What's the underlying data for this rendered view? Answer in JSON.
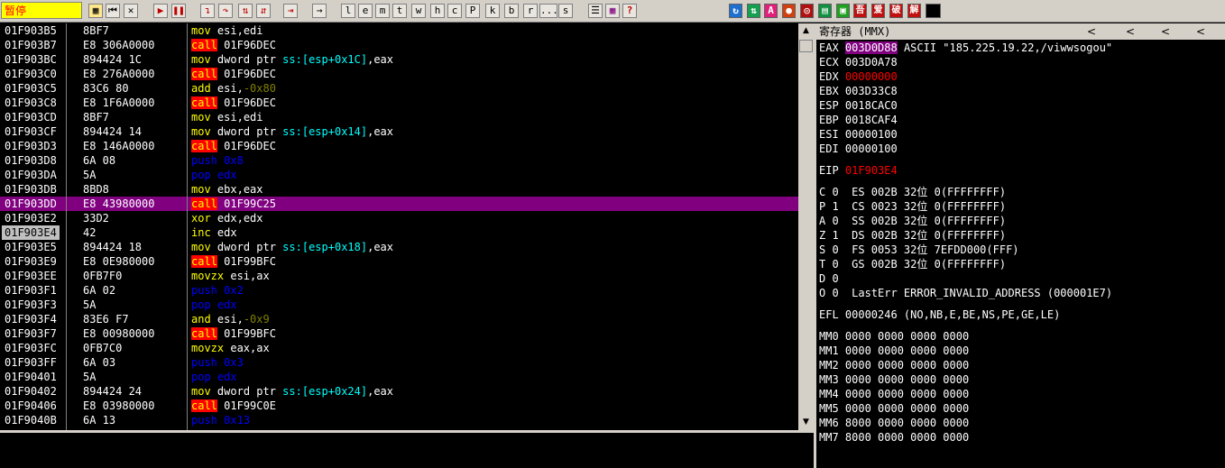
{
  "toolbar": {
    "status": "暂停",
    "buttons": [
      "l",
      "e",
      "m",
      "t",
      "w",
      "h",
      "c",
      "P",
      "k",
      "b",
      "r",
      "...",
      "s"
    ],
    "right_icons": [
      "A",
      "吾",
      "爱",
      "破",
      "解"
    ]
  },
  "disasm": [
    {
      "addr": "01F903B5",
      "hex": "8BF7",
      "mn": "mov",
      "ops": [
        [
          "w",
          "esi,edi"
        ]
      ]
    },
    {
      "addr": "01F903B7",
      "hex": "E8 306A0000",
      "mn": "call",
      "ops": [
        [
          "w",
          "01F96DEC"
        ]
      ]
    },
    {
      "addr": "01F903BC",
      "hex": "894424 1C",
      "mn": "mov",
      "ops": [
        [
          "w",
          "dword ptr "
        ],
        [
          "c",
          "ss:[esp+0x1C]"
        ],
        [
          "w",
          ",eax"
        ]
      ]
    },
    {
      "addr": "01F903C0",
      "hex": "E8 276A0000",
      "mn": "call",
      "ops": [
        [
          "w",
          "01F96DEC"
        ]
      ]
    },
    {
      "addr": "01F903C5",
      "hex": "83C6 80",
      "mn": "add",
      "ops": [
        [
          "w",
          "esi,"
        ],
        [
          "g",
          "-0x80"
        ]
      ]
    },
    {
      "addr": "01F903C8",
      "hex": "E8 1F6A0000",
      "mn": "call",
      "ops": [
        [
          "w",
          "01F96DEC"
        ]
      ]
    },
    {
      "addr": "01F903CD",
      "hex": "8BF7",
      "mn": "mov",
      "ops": [
        [
          "w",
          "esi,edi"
        ]
      ]
    },
    {
      "addr": "01F903CF",
      "hex": "894424 14",
      "mn": "mov",
      "ops": [
        [
          "w",
          "dword ptr "
        ],
        [
          "c",
          "ss:[esp+0x14]"
        ],
        [
          "w",
          ",eax"
        ]
      ]
    },
    {
      "addr": "01F903D3",
      "hex": "E8 146A0000",
      "mn": "call",
      "ops": [
        [
          "w",
          "01F96DEC"
        ]
      ]
    },
    {
      "addr": "01F903D8",
      "hex": "6A 08",
      "mn": "push",
      "ops": [
        [
          "g",
          "0x8"
        ]
      ]
    },
    {
      "addr": "01F903DA",
      "hex": "5A",
      "mn": "pop",
      "ops": [
        [
          "n",
          "edx"
        ]
      ]
    },
    {
      "addr": "01F903DB",
      "hex": "8BD8",
      "mn": "mov",
      "ops": [
        [
          "w",
          "ebx,eax"
        ]
      ]
    },
    {
      "addr": "01F903DD",
      "hex": "E8 43980000",
      "mn": "call",
      "ops": [
        [
          "w",
          "01F99C25"
        ]
      ],
      "sel": true
    },
    {
      "addr": "01F903E2",
      "hex": "33D2",
      "mn": "xor",
      "ops": [
        [
          "w",
          "edx,edx"
        ]
      ]
    },
    {
      "addr": "01F903E4",
      "hex": "42",
      "mn": "inc",
      "ops": [
        [
          "w",
          "edx"
        ]
      ],
      "eip": true
    },
    {
      "addr": "01F903E5",
      "hex": "894424 18",
      "mn": "mov",
      "ops": [
        [
          "w",
          "dword ptr "
        ],
        [
          "c",
          "ss:[esp+0x18]"
        ],
        [
          "w",
          ",eax"
        ]
      ]
    },
    {
      "addr": "01F903E9",
      "hex": "E8 0E980000",
      "mn": "call",
      "ops": [
        [
          "w",
          "01F99BFC"
        ]
      ]
    },
    {
      "addr": "01F903EE",
      "hex": "0FB7F0",
      "mn": "movzx",
      "ops": [
        [
          "w",
          "esi,ax"
        ]
      ]
    },
    {
      "addr": "01F903F1",
      "hex": "6A 02",
      "mn": "push",
      "ops": [
        [
          "g",
          "0x2"
        ]
      ]
    },
    {
      "addr": "01F903F3",
      "hex": "5A",
      "mn": "pop",
      "ops": [
        [
          "n",
          "edx"
        ]
      ]
    },
    {
      "addr": "01F903F4",
      "hex": "83E6 F7",
      "mn": "and",
      "ops": [
        [
          "w",
          "esi,"
        ],
        [
          "g",
          "-0x9"
        ]
      ]
    },
    {
      "addr": "01F903F7",
      "hex": "E8 00980000",
      "mn": "call",
      "ops": [
        [
          "w",
          "01F99BFC"
        ]
      ]
    },
    {
      "addr": "01F903FC",
      "hex": "0FB7C0",
      "mn": "movzx",
      "ops": [
        [
          "w",
          "eax,ax"
        ]
      ]
    },
    {
      "addr": "01F903FF",
      "hex": "6A 03",
      "mn": "push",
      "ops": [
        [
          "g",
          "0x3"
        ]
      ]
    },
    {
      "addr": "01F90401",
      "hex": "5A",
      "mn": "pop",
      "ops": [
        [
          "n",
          "edx"
        ]
      ]
    },
    {
      "addr": "01F90402",
      "hex": "894424 24",
      "mn": "mov",
      "ops": [
        [
          "w",
          "dword ptr "
        ],
        [
          "c",
          "ss:[esp+0x24]"
        ],
        [
          "w",
          ",eax"
        ]
      ]
    },
    {
      "addr": "01F90406",
      "hex": "E8 03980000",
      "mn": "call",
      "ops": [
        [
          "w",
          "01F99C0E"
        ]
      ]
    },
    {
      "addr": "01F9040B",
      "hex": "6A 13",
      "mn": "push",
      "ops": [
        [
          "g",
          "0x13"
        ]
      ]
    }
  ],
  "registers": {
    "title": "寄存器 (MMX)",
    "nav": [
      "<",
      "<",
      "<",
      "<",
      "<"
    ],
    "gp": [
      {
        "name": "EAX",
        "value": "003D0D88",
        "comment": "ASCII \"185.225.19.22,/viwwsogou\"",
        "hl": true
      },
      {
        "name": "ECX",
        "value": "003D0A78",
        "comment": ""
      },
      {
        "name": "EDX",
        "value": "00000000",
        "comment": "",
        "red": true
      },
      {
        "name": "EBX",
        "value": "003D33C8",
        "comment": ""
      },
      {
        "name": "ESP",
        "value": "0018CAC0",
        "comment": ""
      },
      {
        "name": "EBP",
        "value": "0018CAF4",
        "comment": ""
      },
      {
        "name": "ESI",
        "value": "00000100",
        "comment": ""
      },
      {
        "name": "EDI",
        "value": "00000100",
        "comment": ""
      }
    ],
    "eip": {
      "name": "EIP",
      "value": "01F903E4"
    },
    "flags": [
      "C 0  ES 002B 32位 0(FFFFFFFF)",
      "P 1  CS 0023 32位 0(FFFFFFFF)",
      "A 0  SS 002B 32位 0(FFFFFFFF)",
      "Z 1  DS 002B 32位 0(FFFFFFFF)",
      "S 0  FS 0053 32位 7EFDD000(FFF)",
      "T 0  GS 002B 32位 0(FFFFFFFF)",
      "D 0",
      "O 0  LastErr ERROR_INVALID_ADDRESS (000001E7)"
    ],
    "efl": "EFL 00000246 (NO,NB,E,BE,NS,PE,GE,LE)",
    "mmx": [
      "MM0 0000 0000 0000 0000",
      "MM1 0000 0000 0000 0000",
      "MM2 0000 0000 0000 0000",
      "MM3 0000 0000 0000 0000",
      "MM4 0000 0000 0000 0000",
      "MM5 0000 0000 0000 0000",
      "MM6 8000 0000 0000 0000",
      "MM7 8000 0000 0000 0000"
    ]
  }
}
